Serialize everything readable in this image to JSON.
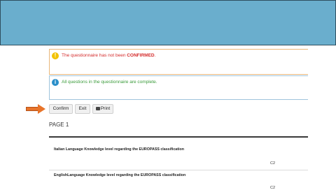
{
  "alerts": {
    "warning_prefix": "The questionnaire has not been ",
    "warning_emphasis": "CONFIRMED",
    "warning_suffix": ".",
    "info": "All questions in the questionnaire are complete."
  },
  "toolbar": {
    "confirm_label": "Confirm",
    "exit_label": "Exit",
    "print_label": "Print"
  },
  "page": {
    "title": "PAGE 1"
  },
  "questions": [
    {
      "label": "Italian Language Knowledge level regarding the EUROPASS classification",
      "value": "C2"
    },
    {
      "label": "EnglishLanguage Knowledge level regarding the EUROPASS classification",
      "value": "C2"
    }
  ],
  "colors": {
    "banner": "#6aaecd",
    "warning_text": "#d42a2a",
    "info_text": "#3a9b3a",
    "arrow": "#e8742a"
  }
}
